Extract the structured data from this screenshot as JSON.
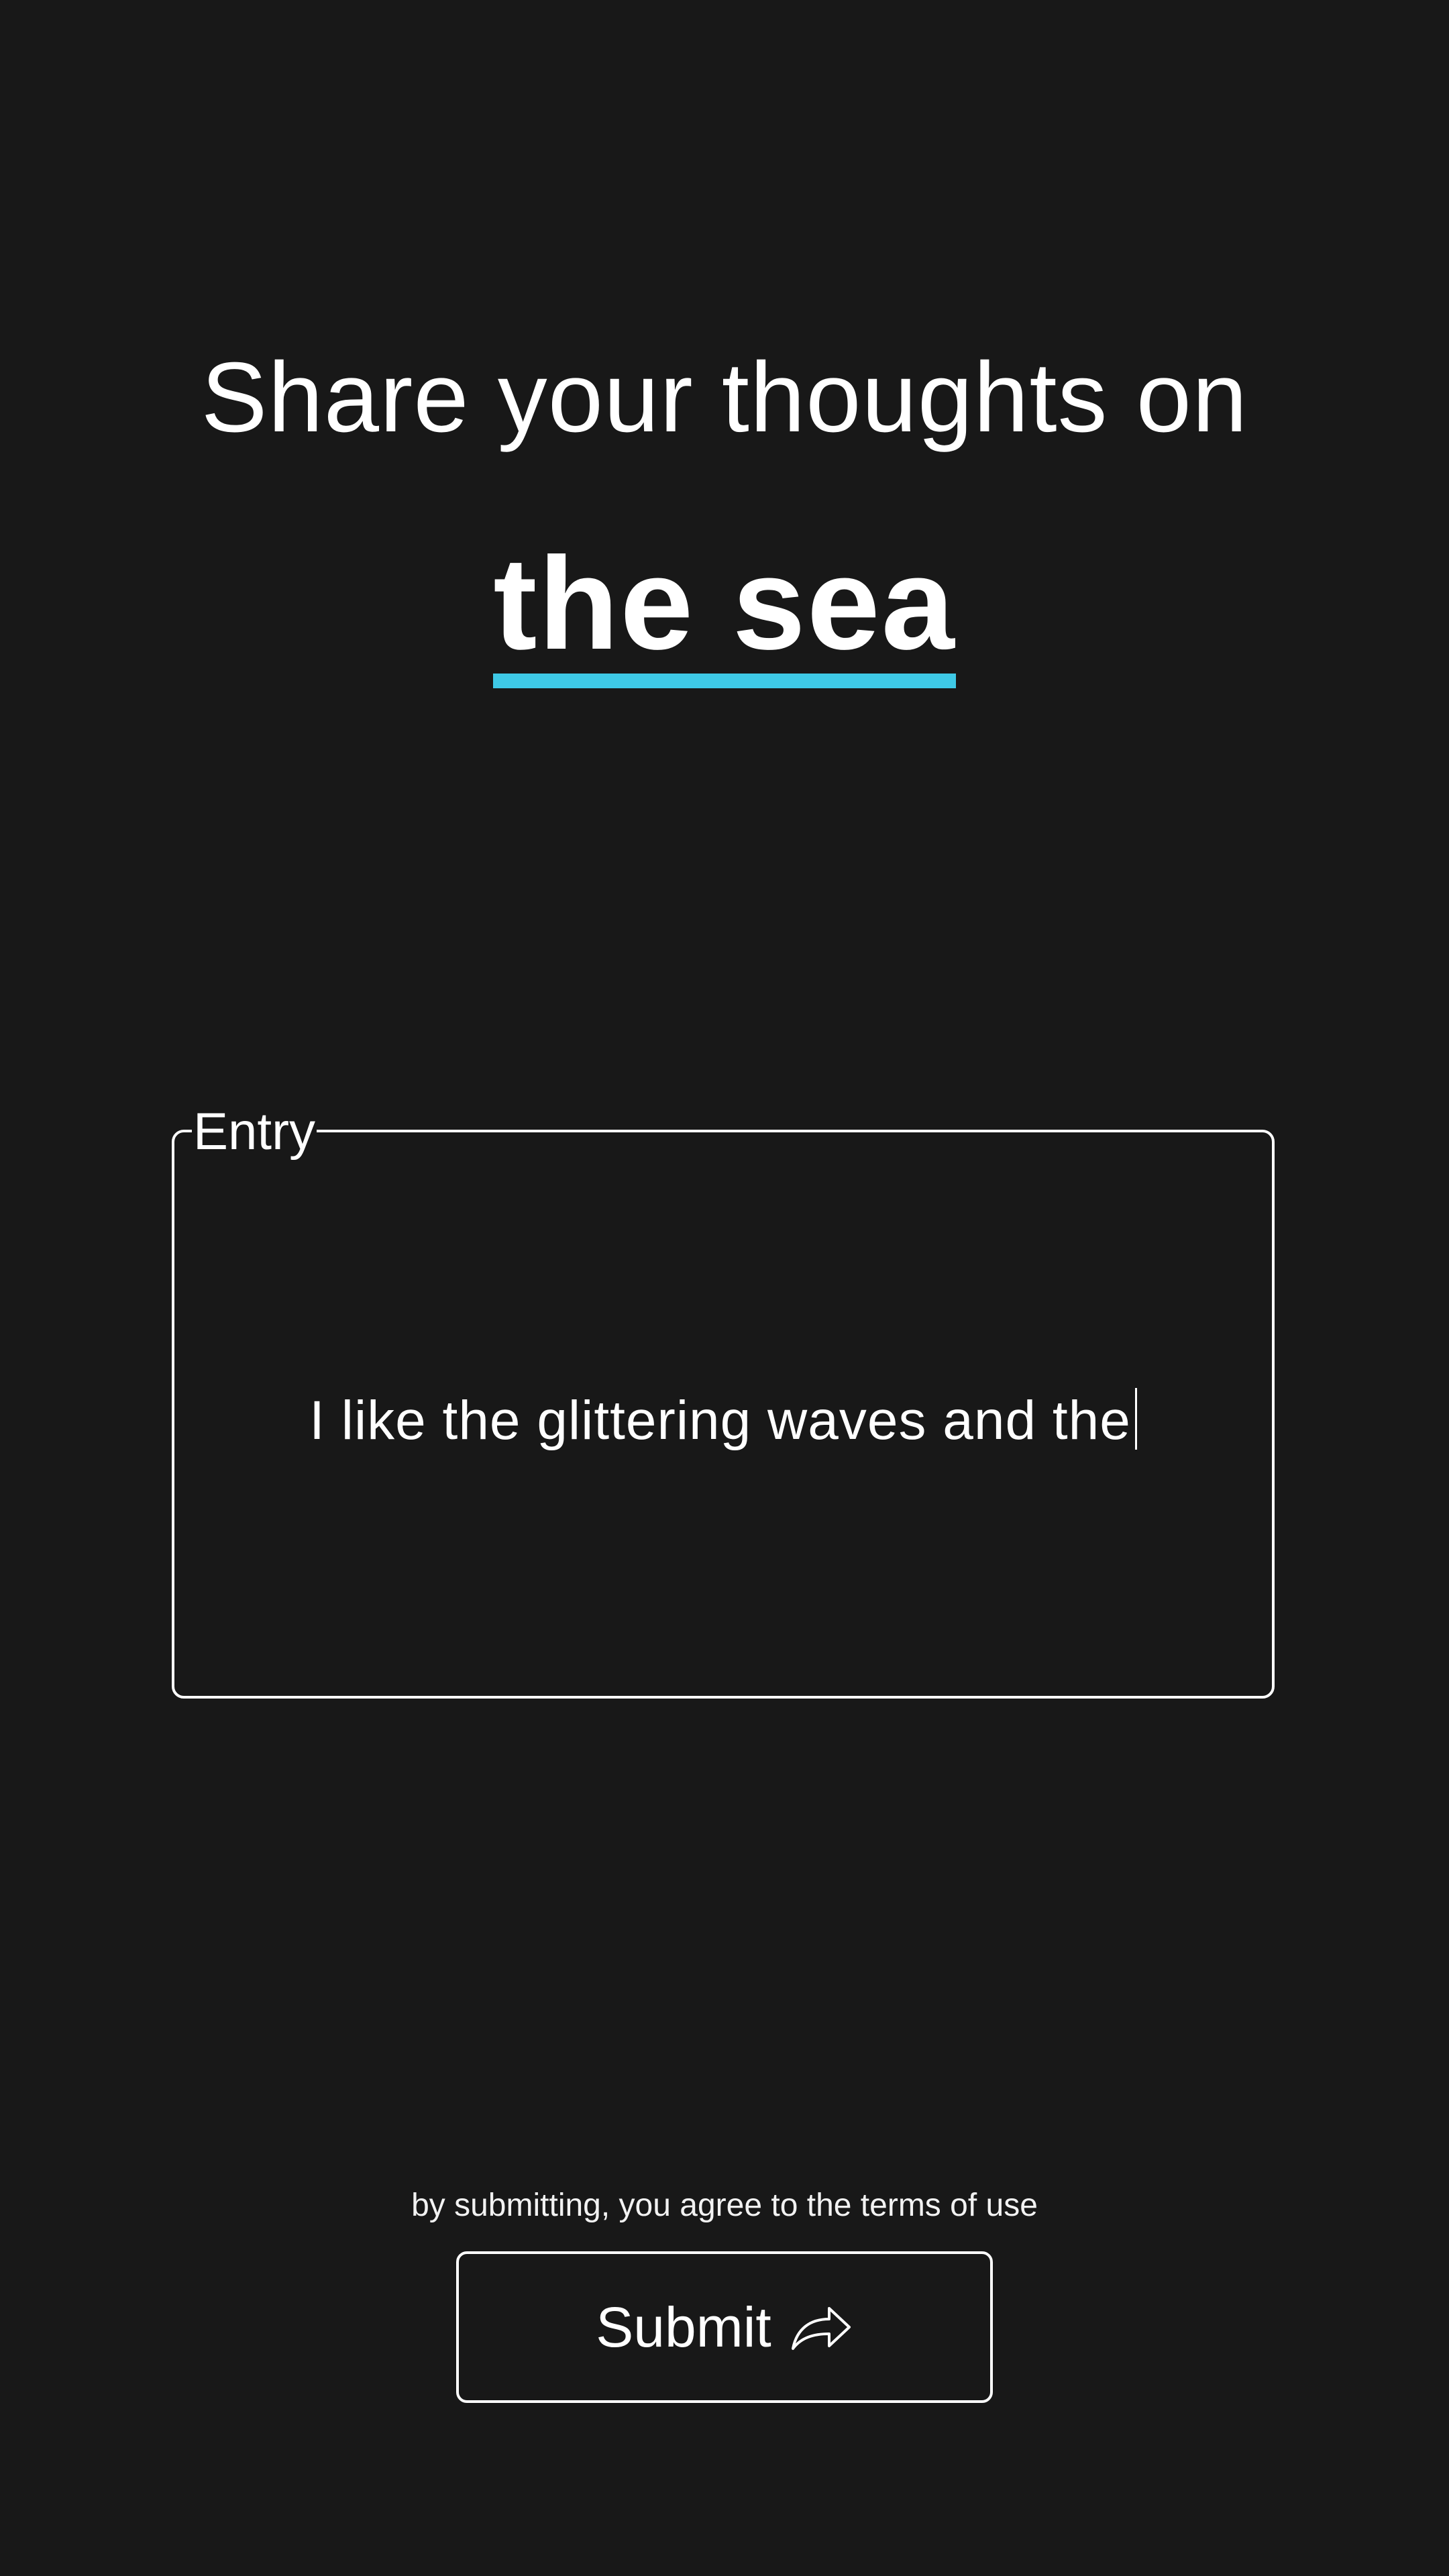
{
  "prompt": {
    "heading": "Share your thoughts on",
    "topic": "the sea"
  },
  "entry": {
    "legend": "Entry",
    "value": "I like the glittering waves and the"
  },
  "footer": {
    "terms_text": "by submitting, you agree to the terms of use",
    "submit_label": "Submit",
    "submit_icon": "share-arrow-icon"
  },
  "colors": {
    "background": "#181818",
    "accent": "#3ec9e6",
    "text": "#ffffff"
  }
}
